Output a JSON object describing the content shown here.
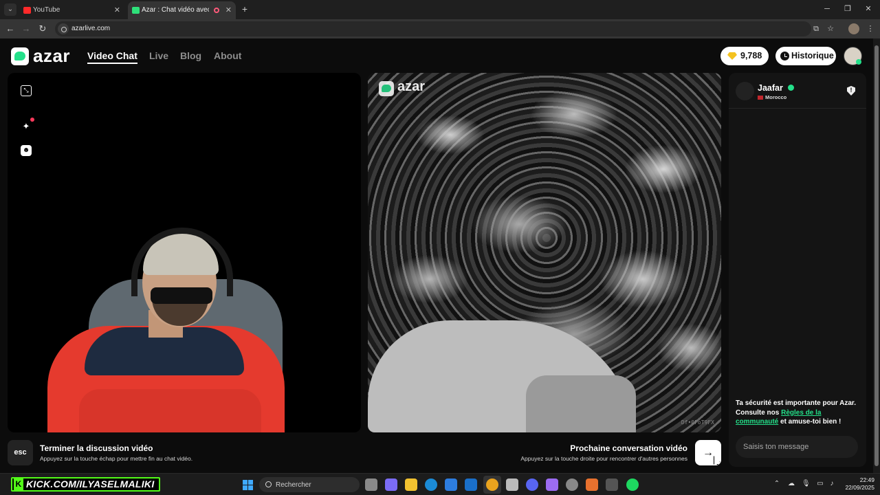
{
  "browser": {
    "tabs": [
      {
        "title": "YouTube",
        "active": false
      },
      {
        "title": "Azar : Chat vidéo avec de n",
        "active": true
      }
    ],
    "url": "azarlive.com"
  },
  "site": {
    "logo_text": "azar",
    "nav": [
      "Video Chat",
      "Live",
      "Blog",
      "About"
    ],
    "gems": "9,788",
    "history_label": "Historique"
  },
  "video": {
    "watermark": "azar",
    "partner_id": "Df•0FoT9FX"
  },
  "chat": {
    "partner_name": "Jaafar",
    "partner_country": "Morocco",
    "safety_text_1": "Ta sécurité est importante pour Azar. Consulte nos ",
    "safety_link": "Règles de la communauté",
    "safety_text_2": " et amuse-toi bien !",
    "input_placeholder": "Saisis ton message"
  },
  "controls": {
    "esc_key": "esc",
    "end_title": "Terminer la discussion vidéo",
    "end_sub": "Appuyez sur la touche échap pour mettre fin au chat vidéo.",
    "next_title": "Prochaine conversation vidéo",
    "next_sub": "Appuyez sur la touche droite pour rencontrer d'autres personnes",
    "next_arrow": "→"
  },
  "taskbar": {
    "stream_banner": "KICK.COM/ILYASELMALIKI",
    "search_placeholder": "Rechercher",
    "time": "22:49",
    "date": "22/09/2025"
  },
  "colors": {
    "accent": "#24e08a",
    "page_bg": "#0c0c0c",
    "kick_green": "#53fc18"
  }
}
